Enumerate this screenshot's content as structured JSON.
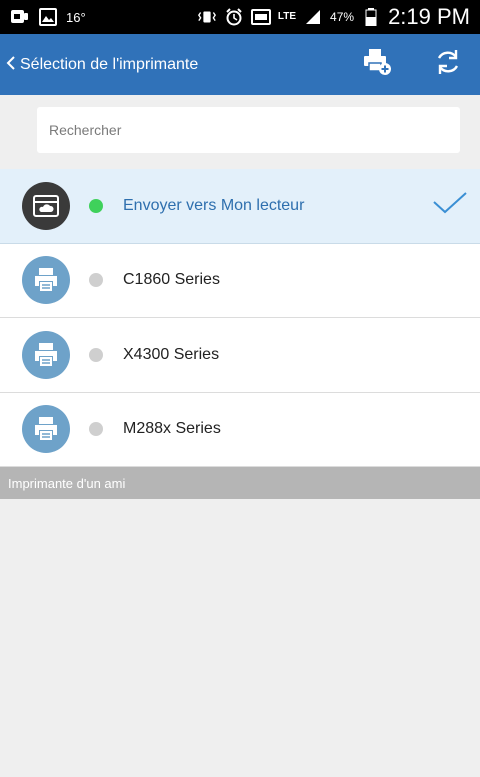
{
  "status_bar": {
    "temperature": "16°",
    "network": "LTE",
    "battery_percent": "47%",
    "time": "2:19 PM"
  },
  "app_bar": {
    "back_label": "Sélection de l'imprimante",
    "add_printer_icon": "printer-add-icon",
    "refresh_icon": "refresh-icon"
  },
  "search": {
    "placeholder": "Rechercher"
  },
  "printers": [
    {
      "label": "Envoyer vers Mon lecteur",
      "icon": "my-drive-icon",
      "online": true,
      "selected": true
    },
    {
      "label": "C1860 Series",
      "icon": "printer-icon",
      "online": false,
      "selected": false
    },
    {
      "label": "X4300 Series",
      "icon": "printer-icon",
      "online": false,
      "selected": false
    },
    {
      "label": "M288x Series",
      "icon": "printer-icon",
      "online": false,
      "selected": false
    }
  ],
  "section": {
    "friend_printers_label": "Imprimante d'un ami"
  },
  "colors": {
    "accent": "#3072b9",
    "online": "#3fd15b",
    "offline": "#cfcfcf",
    "selected_row": "#e3f0fa",
    "printer_avatar": "#6ea2c9",
    "drive_avatar": "#3a3a3a"
  }
}
